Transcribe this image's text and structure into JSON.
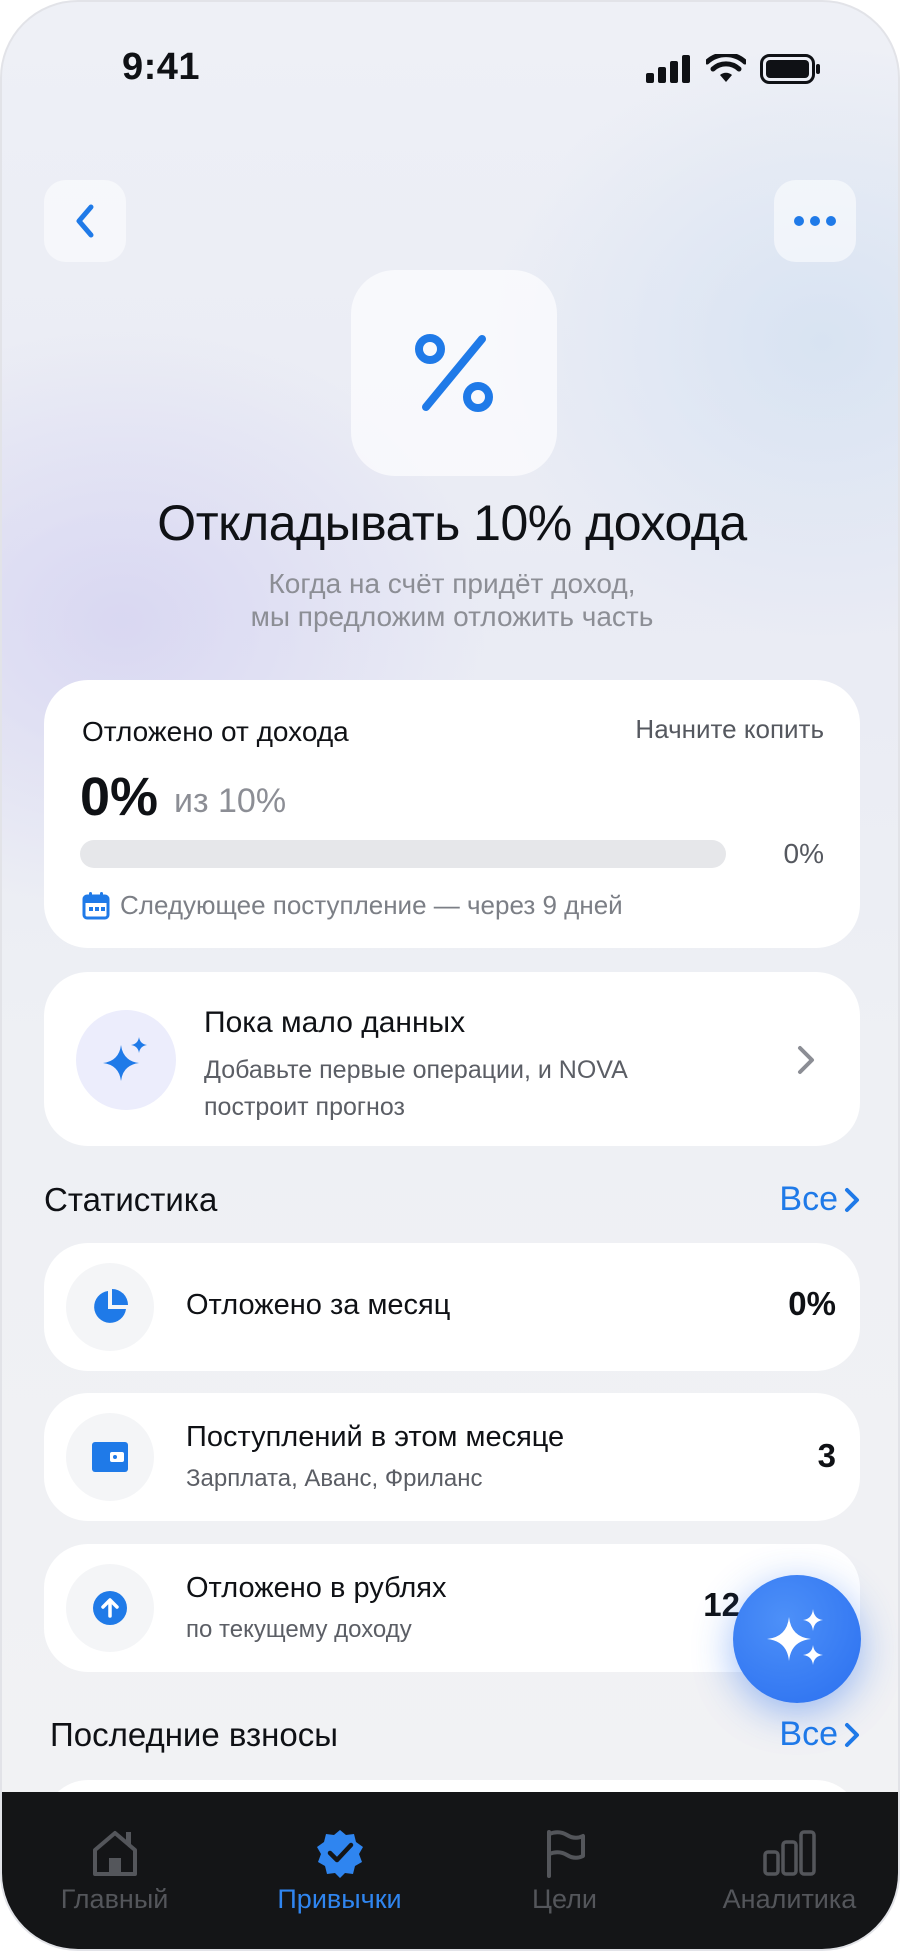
{
  "status_bar": {
    "time": "9:41"
  },
  "header": {
    "icon": "percent-icon",
    "title": "Откладывать 10% дохода",
    "subtitle_line1": "Когда на счёт придёт доход,",
    "subtitle_line2": "мы предложим отложить часть"
  },
  "progress_card": {
    "label": "Отложено от дохода",
    "hint": "Начните копить",
    "value": "0%",
    "of_target": "из 10%",
    "progress_fraction": 0,
    "progress_text": "0%",
    "next_income": "Следующее поступление — через 9 дней"
  },
  "ai_card": {
    "title": "Пока мало данных",
    "description": "Добавьте первые операции, и NOVA построит прогноз"
  },
  "statistics": {
    "title": "Статистика",
    "all_label": "Все",
    "rows": [
      {
        "title": "Отложено за месяц",
        "subtitle": "",
        "value": "0%",
        "icon": "pie-chart-icon"
      },
      {
        "title": "Поступлений в этом месяце",
        "subtitle": "Зарплата, Аванс, Фриланс",
        "value": "3",
        "icon": "wallet-icon"
      },
      {
        "title": "Отложено в рублях",
        "subtitle": "по текущему доходу",
        "value": "12",
        "icon": "arrow-up-circle-icon"
      }
    ]
  },
  "last_contributions": {
    "title": "Последние взносы",
    "all_label": "Все"
  },
  "tabbar": {
    "tabs": [
      {
        "label": "Главный",
        "icon": "home-icon",
        "active": false
      },
      {
        "label": "Привычки",
        "icon": "verified-badge-icon",
        "active": true
      },
      {
        "label": "Цели",
        "icon": "flag-icon",
        "active": false
      },
      {
        "label": "Аналитика",
        "icon": "bar-chart-icon",
        "active": false
      }
    ]
  },
  "colors": {
    "accent": "#1f7ae8",
    "tabbar_bg": "#141517",
    "tab_active": "#2f85f0"
  }
}
